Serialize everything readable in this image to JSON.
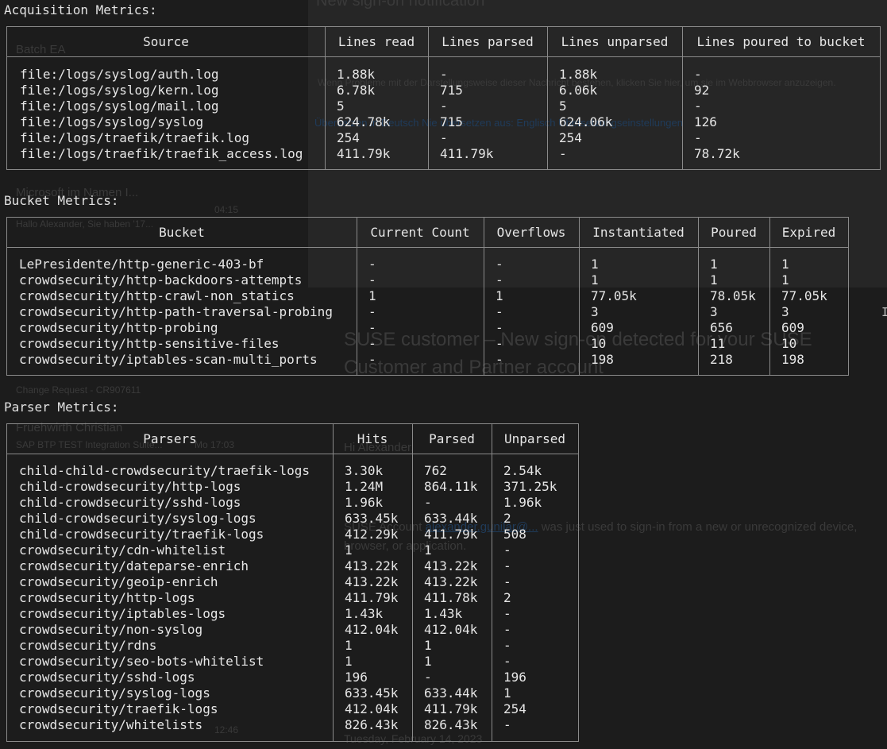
{
  "background": {
    "email_heading_1": "New sign-on notification",
    "sidebar_1": "Batch EA",
    "sidebar_2": "Microsoft im Namen I...",
    "sidebar_3": "Hallo Alexander, Sie haben '17...",
    "sidebar_4": "Fruehwirth Christian",
    "sidebar_5": "SAP BTP TEST Integration Suite...",
    "sidebar_6": "Change Request - CR907611",
    "time_1": "04:15",
    "time_2": "Mo 17:03",
    "time_3": "12:46",
    "email_subject": "SUSE customer – New sign-on detected for your SUSE Customer and Partner account",
    "email_greeting": "Hi Alexander,",
    "email_body_1": "SUSE Account",
    "email_link": "alexander.gunilar@...",
    "email_body_2": "was just used to sign-in from a new or unrecognized device, browser, or application.",
    "email_footer": "Tuesday, February 14, 2023",
    "translate_bar": "Übersetzen in Deutsch    Nie übersetzen aus: Englisch    Übersetzungseinstellungen",
    "info_bar": "Wenn Probleme mit der Darstellungsweise dieser Nachricht bestehen, klicken Sie hier, um sie im Webbrowser anzuzeigen."
  },
  "acquisition": {
    "title": "Acquisition Metrics:",
    "headers": [
      "Source",
      "Lines read",
      "Lines parsed",
      "Lines unparsed",
      "Lines poured to bucket"
    ],
    "rows": [
      [
        "file:/logs/syslog/auth.log",
        "1.88k",
        "-",
        "1.88k",
        "-"
      ],
      [
        "file:/logs/syslog/kern.log",
        "6.78k",
        "715",
        "6.06k",
        "92"
      ],
      [
        "file:/logs/syslog/mail.log",
        "5",
        "-",
        "5",
        "-"
      ],
      [
        "file:/logs/syslog/syslog",
        "624.78k",
        "715",
        "624.06k",
        "126"
      ],
      [
        "file:/logs/traefik/traefik.log",
        "254",
        "-",
        "254",
        "-"
      ],
      [
        "file:/logs/traefik/traefik_access.log",
        "411.79k",
        "411.79k",
        "-",
        "78.72k"
      ]
    ]
  },
  "bucket": {
    "title": "Bucket Metrics:",
    "headers": [
      "Bucket",
      "Current Count",
      "Overflows",
      "Instantiated",
      "Poured",
      "Expired"
    ],
    "rows": [
      [
        "LePresidente/http-generic-403-bf",
        "-",
        "-",
        "1",
        "1",
        "1"
      ],
      [
        "crowdsecurity/http-backdoors-attempts",
        "-",
        "-",
        "1",
        "1",
        "1"
      ],
      [
        "crowdsecurity/http-crawl-non_statics",
        "1",
        "1",
        "77.05k",
        "78.05k",
        "77.05k"
      ],
      [
        "crowdsecurity/http-path-traversal-probing",
        "-",
        "-",
        "3",
        "3",
        "3"
      ],
      [
        "crowdsecurity/http-probing",
        "-",
        "-",
        "609",
        "656",
        "609"
      ],
      [
        "crowdsecurity/http-sensitive-files",
        "-",
        "-",
        "10",
        "11",
        "10"
      ],
      [
        "crowdsecurity/iptables-scan-multi_ports",
        "-",
        "-",
        "198",
        "218",
        "198"
      ]
    ]
  },
  "parser": {
    "title": "Parser Metrics:",
    "headers": [
      "Parsers",
      "Hits",
      "Parsed",
      "Unparsed"
    ],
    "rows": [
      [
        "child-child-crowdsecurity/traefik-logs",
        "3.30k",
        "762",
        "2.54k"
      ],
      [
        "child-crowdsecurity/http-logs",
        "1.24M",
        "864.11k",
        "371.25k"
      ],
      [
        "child-crowdsecurity/sshd-logs",
        "1.96k",
        "-",
        "1.96k"
      ],
      [
        "child-crowdsecurity/syslog-logs",
        "633.45k",
        "633.44k",
        "2"
      ],
      [
        "child-crowdsecurity/traefik-logs",
        "412.29k",
        "411.79k",
        "508"
      ],
      [
        "crowdsecurity/cdn-whitelist",
        "1",
        "1",
        "-"
      ],
      [
        "crowdsecurity/dateparse-enrich",
        "413.22k",
        "413.22k",
        "-"
      ],
      [
        "crowdsecurity/geoip-enrich",
        "413.22k",
        "413.22k",
        "-"
      ],
      [
        "crowdsecurity/http-logs",
        "411.79k",
        "411.78k",
        "2"
      ],
      [
        "crowdsecurity/iptables-logs",
        "1.43k",
        "1.43k",
        "-"
      ],
      [
        "crowdsecurity/non-syslog",
        "412.04k",
        "412.04k",
        "-"
      ],
      [
        "crowdsecurity/rdns",
        "1",
        "1",
        "-"
      ],
      [
        "crowdsecurity/seo-bots-whitelist",
        "1",
        "1",
        "-"
      ],
      [
        "crowdsecurity/sshd-logs",
        "196",
        "-",
        "196"
      ],
      [
        "crowdsecurity/syslog-logs",
        "633.45k",
        "633.44k",
        "1"
      ],
      [
        "crowdsecurity/traefik-logs",
        "412.04k",
        "411.79k",
        "254"
      ],
      [
        "crowdsecurity/whitelists",
        "826.43k",
        "826.43k",
        "-"
      ]
    ]
  }
}
